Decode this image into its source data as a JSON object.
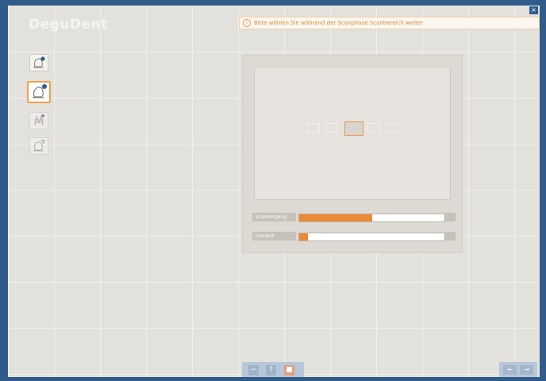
{
  "app": {
    "title": "DeguDent",
    "close_glyph": "×"
  },
  "message": {
    "icon": "info-icon",
    "icon_glyph": "i",
    "text": "Bitte wählen Sie während der Scanphase Scanbereich weiter"
  },
  "toolbar": {
    "items": [
      {
        "name": "scan-single-die-icon",
        "active": false
      },
      {
        "name": "scan-die-active-icon",
        "active": true
      },
      {
        "name": "scan-bridge-icon",
        "active": false
      },
      {
        "name": "scan-export-icon",
        "active": false
      }
    ]
  },
  "viewer": {
    "teeth_count": 5,
    "selected_tooth_index": 2
  },
  "progress": [
    {
      "label": "Scanvorgang",
      "value": 0.5
    },
    {
      "label": "Gesamt",
      "value": 0.06
    }
  ],
  "bottom_toolbar": {
    "buttons": [
      {
        "name": "minus-button",
        "glyph": "−"
      },
      {
        "name": "help-button",
        "glyph": "?"
      },
      {
        "name": "stop-button",
        "glyph": "■"
      }
    ]
  },
  "navigation": {
    "back_glyph": "←",
    "forward_glyph": "→"
  },
  "colors": {
    "frame": "#2f5c8a",
    "accent": "#ea8a34",
    "background": "#e3e1dc"
  }
}
